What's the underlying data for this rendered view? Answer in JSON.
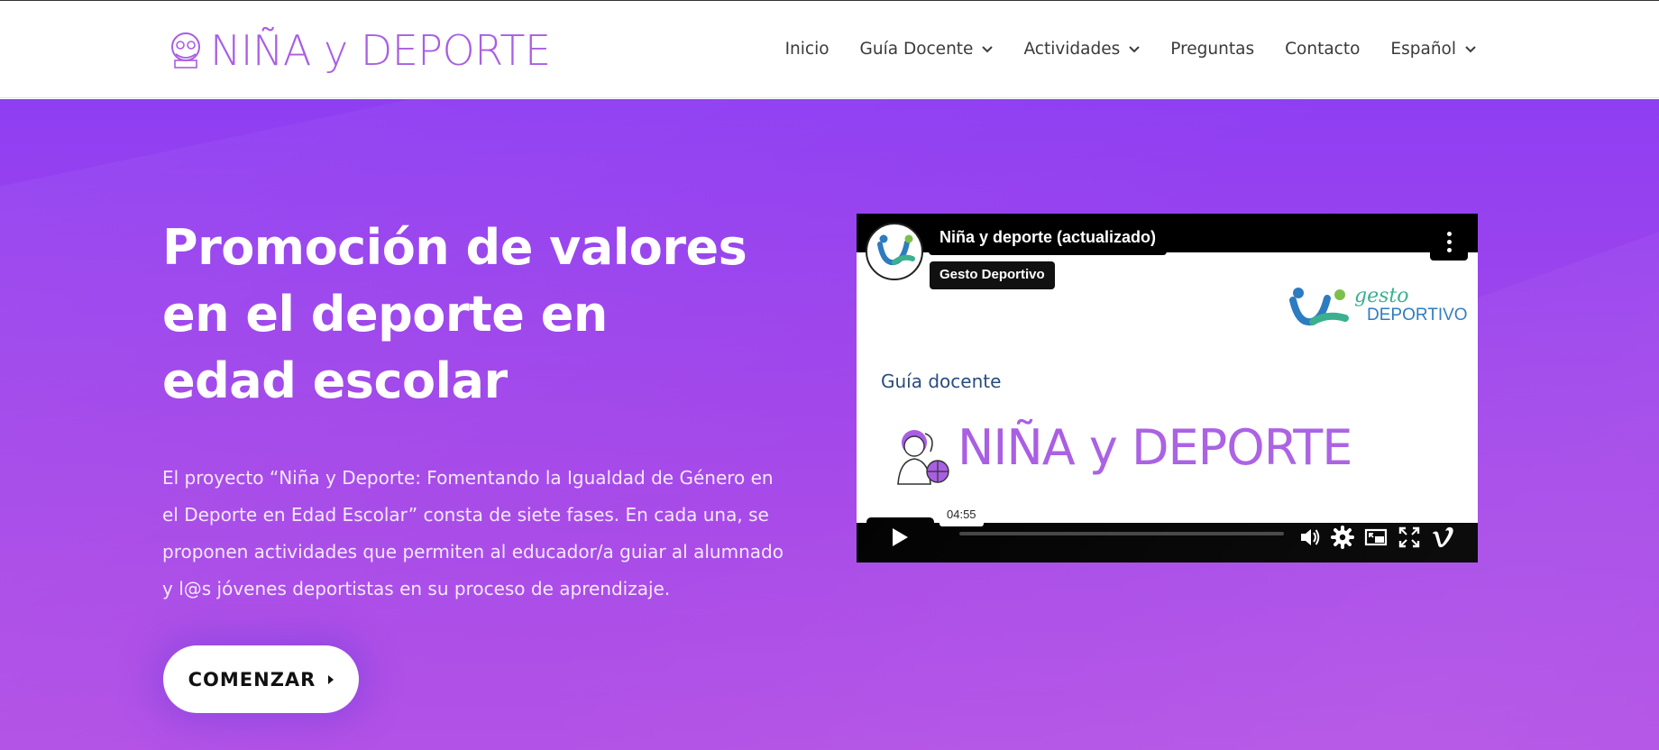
{
  "header": {
    "logo_text": "NIÑA y DEPORTE",
    "nav": [
      {
        "label": "Inicio",
        "has_dropdown": false
      },
      {
        "label": "Guía Docente",
        "has_dropdown": true
      },
      {
        "label": "Actividades",
        "has_dropdown": true
      },
      {
        "label": "Preguntas",
        "has_dropdown": false
      },
      {
        "label": "Contacto",
        "has_dropdown": false
      },
      {
        "label": "Español",
        "has_dropdown": true
      }
    ]
  },
  "hero": {
    "title": "Promoción de valores en el deporte en edad escolar",
    "description": "El proyecto “Niña y Deporte: Fomentando la Igualdad de Género en el Deporte en Edad Escolar” consta de siete fases. En cada una, se proponen actividades que permiten al educador/a guiar al alumnado y l@s jóvenes deportistas en su proceso de aprendizaje.",
    "cta_label": "COMENZAR"
  },
  "video": {
    "title": "Niña y deporte (actualizado)",
    "channel": "Gesto Deportivo",
    "brand_line1": "gesto",
    "brand_line2": "DEPORTIVO",
    "guide_label": "Guía docente",
    "brand_title": "NIÑA y DEPORTE",
    "duration": "04:55",
    "progress": 0
  },
  "colors": {
    "accent": "#a95ee3",
    "hero_top": "#8f3ef2",
    "hero_bottom": "#b352e6"
  }
}
